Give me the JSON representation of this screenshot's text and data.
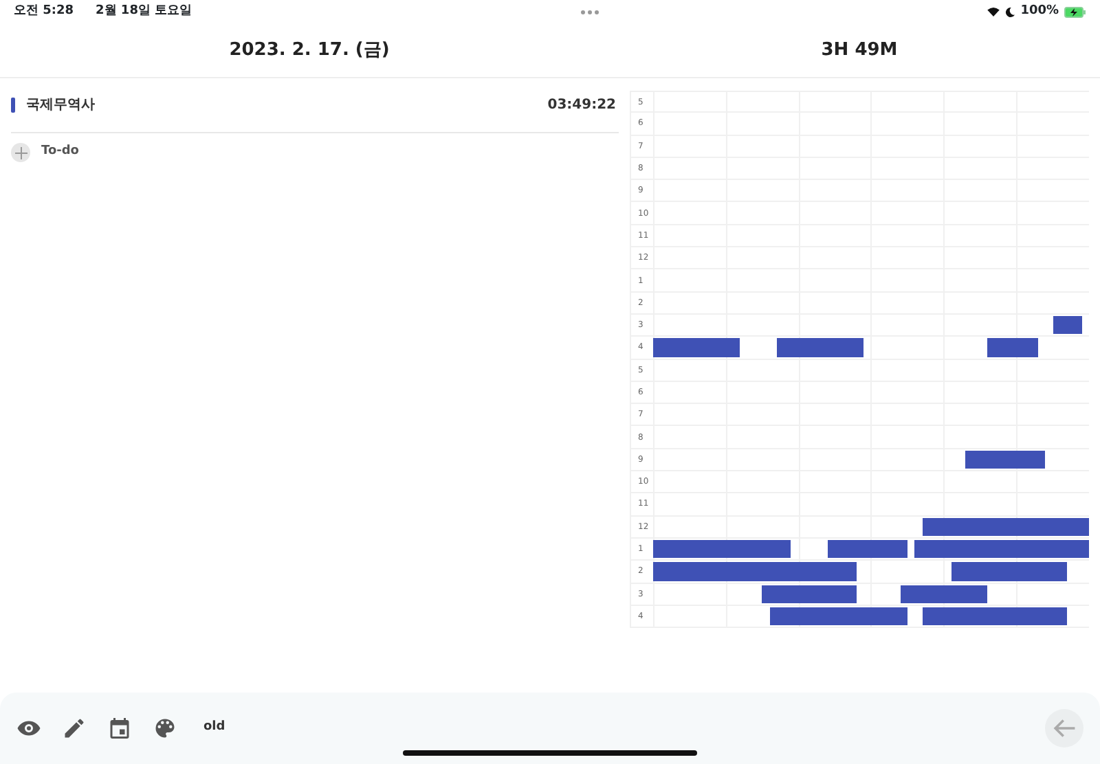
{
  "status_bar": {
    "time": "오전 5:28",
    "date": "2월 18일 토요일",
    "battery": "100%",
    "charging": true
  },
  "header": {
    "date": "2023. 2. 17. (금)",
    "total": "3H 49M"
  },
  "subjects": [
    {
      "name": "국제무역사",
      "time": "03:49:22",
      "color": "#3f51b5"
    }
  ],
  "add_todo": {
    "label": "To-do"
  },
  "timeline": {
    "rows": [
      {
        "hour": "5"
      },
      {
        "hour": "6"
      },
      {
        "hour": "7"
      },
      {
        "hour": "8"
      },
      {
        "hour": "9"
      },
      {
        "hour": "10"
      },
      {
        "hour": "11"
      },
      {
        "hour": "12"
      },
      {
        "hour": "1"
      },
      {
        "hour": "2"
      },
      {
        "hour": "3",
        "segments": [
          {
            "kind": "gap"
          },
          {
            "kind": "study"
          }
        ]
      },
      {
        "hour": "4",
        "segments": [
          {
            "kind": "study"
          },
          {
            "kind": "gap"
          },
          {
            "kind": "study"
          },
          {
            "kind": "gap"
          },
          {
            "kind": "study"
          }
        ]
      },
      {
        "hour": "5"
      },
      {
        "hour": "6"
      },
      {
        "hour": "7"
      },
      {
        "hour": "8"
      },
      {
        "hour": "9",
        "segments": [
          {
            "kind": "gap"
          },
          {
            "kind": "study"
          }
        ]
      },
      {
        "hour": "10"
      },
      {
        "hour": "11"
      },
      {
        "hour": "12",
        "segments": [
          {
            "kind": "gap"
          },
          {
            "kind": "study"
          }
        ]
      },
      {
        "hour": "1",
        "segments": [
          {
            "kind": "study"
          },
          {
            "kind": "gap"
          },
          {
            "kind": "study"
          },
          {
            "kind": "gap"
          },
          {
            "kind": "study"
          }
        ]
      },
      {
        "hour": "2",
        "segments": [
          {
            "kind": "study"
          },
          {
            "kind": "gap"
          },
          {
            "kind": "study"
          }
        ]
      },
      {
        "hour": "3",
        "segments": [
          {
            "kind": "gap"
          },
          {
            "kind": "study"
          },
          {
            "kind": "gap"
          },
          {
            "kind": "study"
          }
        ]
      },
      {
        "hour": "4",
        "segments": [
          {
            "kind": "gap"
          },
          {
            "kind": "study"
          },
          {
            "kind": "gap"
          },
          {
            "kind": "study"
          }
        ]
      }
    ]
  },
  "toolbar": {
    "label": "old"
  }
}
